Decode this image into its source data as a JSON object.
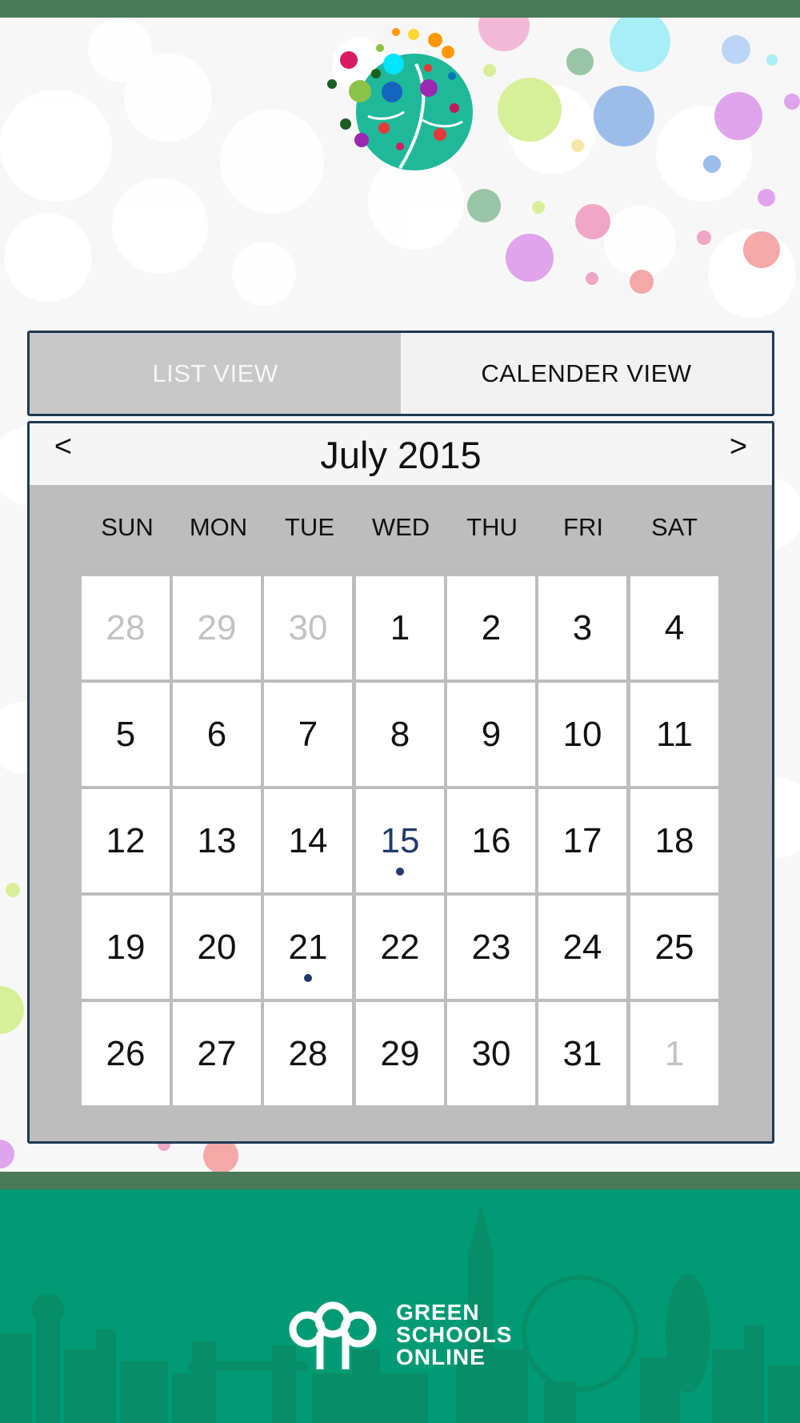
{
  "tabs": {
    "list": "LIST VIEW",
    "calendar": "CALENDER VIEW"
  },
  "calendar": {
    "prev_label": "<",
    "next_label": ">",
    "month_title": "July 2015",
    "weekdays": [
      "SUN",
      "MON",
      "TUE",
      "WED",
      "THU",
      "FRI",
      "SAT"
    ],
    "weeks": [
      [
        {
          "d": "28",
          "muted": true
        },
        {
          "d": "29",
          "muted": true
        },
        {
          "d": "30",
          "muted": true
        },
        {
          "d": "1"
        },
        {
          "d": "2"
        },
        {
          "d": "3"
        },
        {
          "d": "4"
        }
      ],
      [
        {
          "d": "5"
        },
        {
          "d": "6"
        },
        {
          "d": "7"
        },
        {
          "d": "8"
        },
        {
          "d": "9"
        },
        {
          "d": "10"
        },
        {
          "d": "11"
        }
      ],
      [
        {
          "d": "12"
        },
        {
          "d": "13"
        },
        {
          "d": "14"
        },
        {
          "d": "15",
          "today": true,
          "event": true
        },
        {
          "d": "16"
        },
        {
          "d": "17"
        },
        {
          "d": "18"
        }
      ],
      [
        {
          "d": "19"
        },
        {
          "d": "20"
        },
        {
          "d": "21",
          "event": true
        },
        {
          "d": "22"
        },
        {
          "d": "23"
        },
        {
          "d": "24"
        },
        {
          "d": "25"
        }
      ],
      [
        {
          "d": "26"
        },
        {
          "d": "27"
        },
        {
          "d": "28"
        },
        {
          "d": "29"
        },
        {
          "d": "30"
        },
        {
          "d": "31"
        },
        {
          "d": "1",
          "muted": true
        }
      ]
    ]
  },
  "footer": {
    "brand_line1": "GREEN",
    "brand_line2": "SCHOOLS",
    "brand_line3": "ONLINE"
  },
  "colors": {
    "top_bar": "#4a7a57",
    "frame_border": "#1e3a52",
    "footer_green": "#009b74",
    "event_dot": "#1f3a6b",
    "today_text": "#1f3a6b"
  },
  "icons": {
    "logo": "globe-tree-logo-icon",
    "brand": "green-schools-logo-icon"
  }
}
